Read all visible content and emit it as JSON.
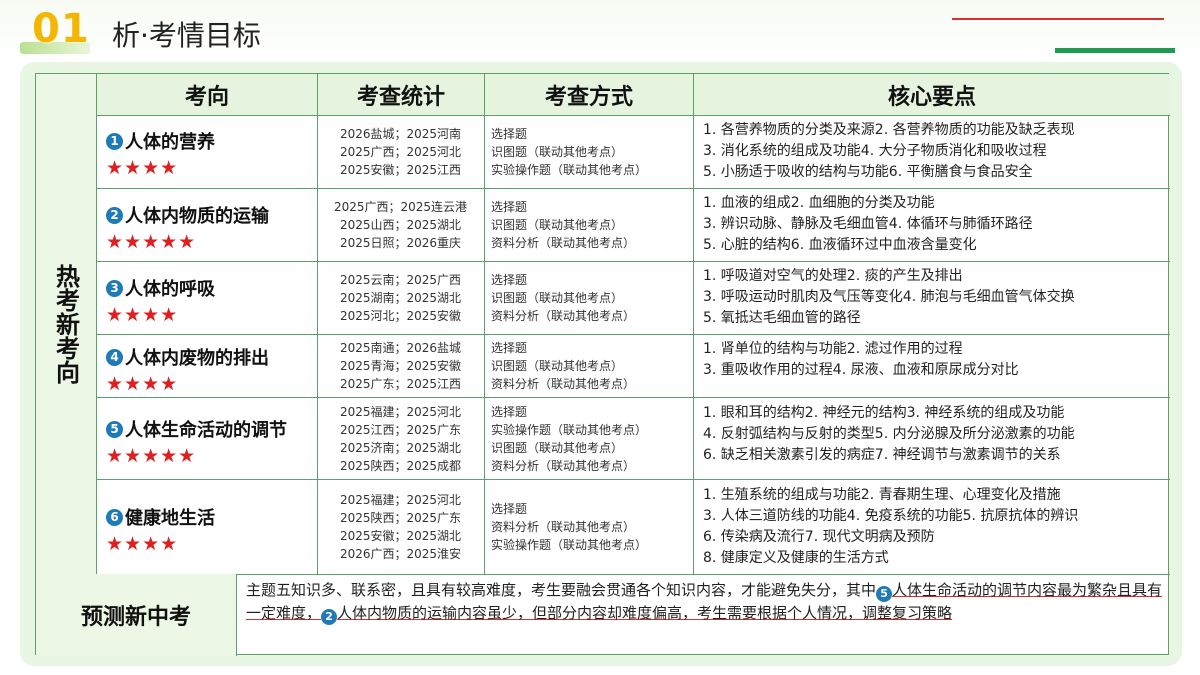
{
  "header": {
    "number": "01",
    "title": "析·考情目标"
  },
  "side_label": "热考新考向",
  "columns": [
    "考向",
    "考查统计",
    "考查方式",
    "核心要点"
  ],
  "rows": [
    {
      "num": "1",
      "topic": "人体的营养",
      "stars": "★★★★",
      "stats": [
        "2026盐城；2025河南",
        "2025广西；2025河北",
        "2025安徽；2025江西"
      ],
      "methods": [
        "选择题",
        "识图题（联动其他考点）",
        "实验操作题（联动其他考点）"
      ],
      "points": [
        "1. 各营养物质的分类及来源2. 各营养物质的功能及缺乏表现",
        "3. 消化系统的组成及功能4. 大分子物质消化和吸收过程",
        "5. 小肠适于吸收的结构与功能6. 平衡膳食与食品安全"
      ]
    },
    {
      "num": "2",
      "topic": "人体内物质的运输",
      "stars": "★★★★★",
      "stats": [
        "2025广西；2025连云港",
        "2025山西；2025湖北",
        "2025日照；2026重庆"
      ],
      "methods": [
        "选择题",
        "识图题（联动其他考点）",
        "资料分析（联动其他考点）"
      ],
      "points": [
        "1. 血液的组成2. 血细胞的分类及功能",
        "3. 辨识动脉、静脉及毛细血管4. 体循环与肺循环路径",
        "5. 心脏的结构6. 血液循环过中血液含量变化"
      ]
    },
    {
      "num": "3",
      "topic": "人体的呼吸",
      "stars": "★★★★",
      "stats": [
        "2025云南；2025广西",
        "2025湖南；2025湖北",
        "2025河北；2025安徽"
      ],
      "methods": [
        "选择题",
        "识图题（联动其他考点）",
        "资料分析（联动其他考点）"
      ],
      "points": [
        "1. 呼吸道对空气的处理2. 痰的产生及排出",
        "3. 呼吸运动时肌肉及气压等变化4. 肺泡与毛细血管气体交换",
        "5. 氧抵达毛细血管的路径"
      ]
    },
    {
      "num": "4",
      "topic": "人体内废物的排出",
      "stars": "★★★★",
      "stats": [
        "2025南通；2026盐城",
        "2025青海；2025安徽",
        "2025广东；2025江西"
      ],
      "methods": [
        "选择题",
        "识图题（联动其他考点）",
        "资料分析（联动其他考点）"
      ],
      "points": [
        "1. 肾单位的结构与功能2. 滤过作用的过程",
        "3. 重吸收作用的过程4. 尿液、血液和原尿成分对比"
      ]
    },
    {
      "num": "5",
      "topic": "人体生命活动的调节",
      "stars": "★★★★★",
      "stats": [
        "2025福建；2025河北",
        "2025江西；2025广东",
        "2025济南；2025湖北",
        "2025陕西；2025成都"
      ],
      "methods": [
        "选择题",
        "实验操作题（联动其他考点）",
        "识图题（联动其他考点）",
        "资料分析（联动其他考点）"
      ],
      "points": [
        "1. 眼和耳的结构2. 神经元的结构3. 神经系统的组成及功能",
        "4. 反射弧结构与反射的类型5. 内分泌腺及所分泌激素的功能",
        "6. 缺乏相关激素引发的病症7. 神经调节与激素调节的关系"
      ]
    },
    {
      "num": "6",
      "topic": "健康地生活",
      "stars": "★★★★",
      "stats": [
        "2025福建；2025河北",
        "2025陕西；2025广东",
        "2025安徽；2025湖北",
        "2026广西；2025淮安"
      ],
      "methods": [
        "选择题",
        "资料分析（联动其他考点）",
        "实验操作题（联动其他考点）"
      ],
      "points": [
        "1. 生殖系统的组成与功能2. 青春期生理、心理变化及措施",
        "3. 人体三道防线的功能4. 免疫系统的功能5. 抗原抗体的辨识",
        "6. 传染病及流行7. 现代文明病及预防",
        "8. 健康定义及健康的生活方式"
      ]
    }
  ],
  "prediction": {
    "label": "预测新中考",
    "part1": "主题五知识多、联系密，且具有较高难度，考生要融会贯通各个知识内容，才能避免失分，其中",
    "num1": "5",
    "part2": "人体生命活动的调节内容最为繁杂且具有一定难度，",
    "num2": "2",
    "part3": "人体内物质的运输内容虽少，但部分内容却难度偏高，考生需要根据个人情况，调整复习策略"
  }
}
